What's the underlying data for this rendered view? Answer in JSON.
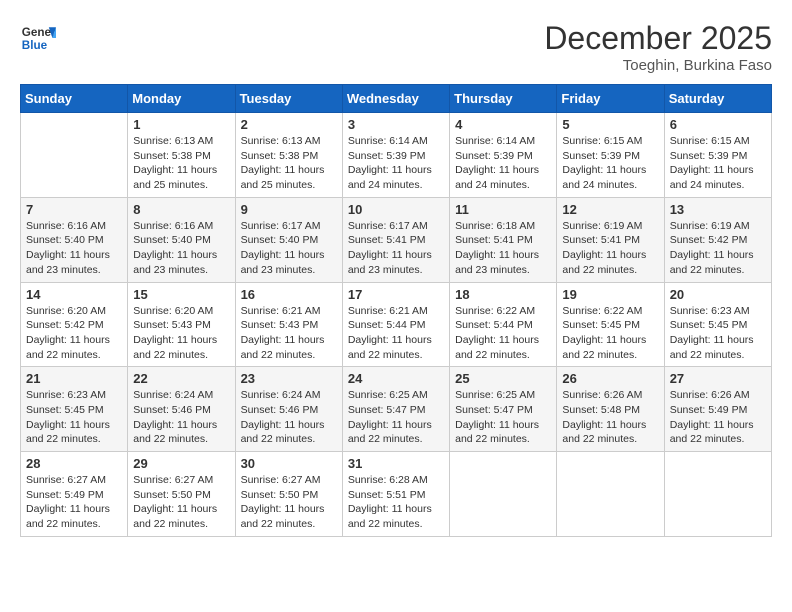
{
  "header": {
    "logo_line1": "General",
    "logo_line2": "Blue",
    "month": "December 2025",
    "location": "Toeghin, Burkina Faso"
  },
  "days_of_week": [
    "Sunday",
    "Monday",
    "Tuesday",
    "Wednesday",
    "Thursday",
    "Friday",
    "Saturday"
  ],
  "weeks": [
    [
      {
        "day": "",
        "sunrise": "",
        "sunset": "",
        "daylight": ""
      },
      {
        "day": "1",
        "sunrise": "Sunrise: 6:13 AM",
        "sunset": "Sunset: 5:38 PM",
        "daylight": "Daylight: 11 hours and 25 minutes."
      },
      {
        "day": "2",
        "sunrise": "Sunrise: 6:13 AM",
        "sunset": "Sunset: 5:38 PM",
        "daylight": "Daylight: 11 hours and 25 minutes."
      },
      {
        "day": "3",
        "sunrise": "Sunrise: 6:14 AM",
        "sunset": "Sunset: 5:39 PM",
        "daylight": "Daylight: 11 hours and 24 minutes."
      },
      {
        "day": "4",
        "sunrise": "Sunrise: 6:14 AM",
        "sunset": "Sunset: 5:39 PM",
        "daylight": "Daylight: 11 hours and 24 minutes."
      },
      {
        "day": "5",
        "sunrise": "Sunrise: 6:15 AM",
        "sunset": "Sunset: 5:39 PM",
        "daylight": "Daylight: 11 hours and 24 minutes."
      },
      {
        "day": "6",
        "sunrise": "Sunrise: 6:15 AM",
        "sunset": "Sunset: 5:39 PM",
        "daylight": "Daylight: 11 hours and 24 minutes."
      }
    ],
    [
      {
        "day": "7",
        "sunrise": "Sunrise: 6:16 AM",
        "sunset": "Sunset: 5:40 PM",
        "daylight": "Daylight: 11 hours and 23 minutes."
      },
      {
        "day": "8",
        "sunrise": "Sunrise: 6:16 AM",
        "sunset": "Sunset: 5:40 PM",
        "daylight": "Daylight: 11 hours and 23 minutes."
      },
      {
        "day": "9",
        "sunrise": "Sunrise: 6:17 AM",
        "sunset": "Sunset: 5:40 PM",
        "daylight": "Daylight: 11 hours and 23 minutes."
      },
      {
        "day": "10",
        "sunrise": "Sunrise: 6:17 AM",
        "sunset": "Sunset: 5:41 PM",
        "daylight": "Daylight: 11 hours and 23 minutes."
      },
      {
        "day": "11",
        "sunrise": "Sunrise: 6:18 AM",
        "sunset": "Sunset: 5:41 PM",
        "daylight": "Daylight: 11 hours and 23 minutes."
      },
      {
        "day": "12",
        "sunrise": "Sunrise: 6:19 AM",
        "sunset": "Sunset: 5:41 PM",
        "daylight": "Daylight: 11 hours and 22 minutes."
      },
      {
        "day": "13",
        "sunrise": "Sunrise: 6:19 AM",
        "sunset": "Sunset: 5:42 PM",
        "daylight": "Daylight: 11 hours and 22 minutes."
      }
    ],
    [
      {
        "day": "14",
        "sunrise": "Sunrise: 6:20 AM",
        "sunset": "Sunset: 5:42 PM",
        "daylight": "Daylight: 11 hours and 22 minutes."
      },
      {
        "day": "15",
        "sunrise": "Sunrise: 6:20 AM",
        "sunset": "Sunset: 5:43 PM",
        "daylight": "Daylight: 11 hours and 22 minutes."
      },
      {
        "day": "16",
        "sunrise": "Sunrise: 6:21 AM",
        "sunset": "Sunset: 5:43 PM",
        "daylight": "Daylight: 11 hours and 22 minutes."
      },
      {
        "day": "17",
        "sunrise": "Sunrise: 6:21 AM",
        "sunset": "Sunset: 5:44 PM",
        "daylight": "Daylight: 11 hours and 22 minutes."
      },
      {
        "day": "18",
        "sunrise": "Sunrise: 6:22 AM",
        "sunset": "Sunset: 5:44 PM",
        "daylight": "Daylight: 11 hours and 22 minutes."
      },
      {
        "day": "19",
        "sunrise": "Sunrise: 6:22 AM",
        "sunset": "Sunset: 5:45 PM",
        "daylight": "Daylight: 11 hours and 22 minutes."
      },
      {
        "day": "20",
        "sunrise": "Sunrise: 6:23 AM",
        "sunset": "Sunset: 5:45 PM",
        "daylight": "Daylight: 11 hours and 22 minutes."
      }
    ],
    [
      {
        "day": "21",
        "sunrise": "Sunrise: 6:23 AM",
        "sunset": "Sunset: 5:45 PM",
        "daylight": "Daylight: 11 hours and 22 minutes."
      },
      {
        "day": "22",
        "sunrise": "Sunrise: 6:24 AM",
        "sunset": "Sunset: 5:46 PM",
        "daylight": "Daylight: 11 hours and 22 minutes."
      },
      {
        "day": "23",
        "sunrise": "Sunrise: 6:24 AM",
        "sunset": "Sunset: 5:46 PM",
        "daylight": "Daylight: 11 hours and 22 minutes."
      },
      {
        "day": "24",
        "sunrise": "Sunrise: 6:25 AM",
        "sunset": "Sunset: 5:47 PM",
        "daylight": "Daylight: 11 hours and 22 minutes."
      },
      {
        "day": "25",
        "sunrise": "Sunrise: 6:25 AM",
        "sunset": "Sunset: 5:47 PM",
        "daylight": "Daylight: 11 hours and 22 minutes."
      },
      {
        "day": "26",
        "sunrise": "Sunrise: 6:26 AM",
        "sunset": "Sunset: 5:48 PM",
        "daylight": "Daylight: 11 hours and 22 minutes."
      },
      {
        "day": "27",
        "sunrise": "Sunrise: 6:26 AM",
        "sunset": "Sunset: 5:49 PM",
        "daylight": "Daylight: 11 hours and 22 minutes."
      }
    ],
    [
      {
        "day": "28",
        "sunrise": "Sunrise: 6:27 AM",
        "sunset": "Sunset: 5:49 PM",
        "daylight": "Daylight: 11 hours and 22 minutes."
      },
      {
        "day": "29",
        "sunrise": "Sunrise: 6:27 AM",
        "sunset": "Sunset: 5:50 PM",
        "daylight": "Daylight: 11 hours and 22 minutes."
      },
      {
        "day": "30",
        "sunrise": "Sunrise: 6:27 AM",
        "sunset": "Sunset: 5:50 PM",
        "daylight": "Daylight: 11 hours and 22 minutes."
      },
      {
        "day": "31",
        "sunrise": "Sunrise: 6:28 AM",
        "sunset": "Sunset: 5:51 PM",
        "daylight": "Daylight: 11 hours and 22 minutes."
      },
      {
        "day": "",
        "sunrise": "",
        "sunset": "",
        "daylight": ""
      },
      {
        "day": "",
        "sunrise": "",
        "sunset": "",
        "daylight": ""
      },
      {
        "day": "",
        "sunrise": "",
        "sunset": "",
        "daylight": ""
      }
    ]
  ]
}
